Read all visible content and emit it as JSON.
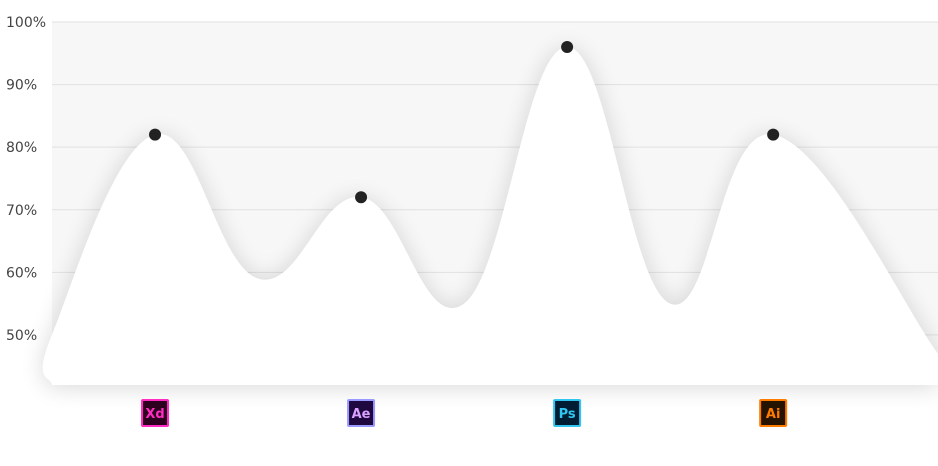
{
  "chart_data": {
    "type": "area",
    "title": "",
    "xlabel": "",
    "ylabel": "",
    "ylim": [
      42,
      100
    ],
    "y_ticks": [
      50,
      60,
      70,
      80,
      90,
      100
    ],
    "y_tick_labels": [
      "50%",
      "60%",
      "70%",
      "80%",
      "90%",
      "100%"
    ],
    "grid": true,
    "curve_color": "#ffffff",
    "background_band_color": "#f7f7f7",
    "point_color": "#222222",
    "series": [
      {
        "name": "",
        "points": [
          {
            "x": 0.0,
            "y": 42
          },
          {
            "x": 0.0,
            "y": 50
          },
          {
            "x": 0.5,
            "y": 82,
            "marker": true
          },
          {
            "x": 1.0,
            "y": 59
          },
          {
            "x": 1.5,
            "y": 72,
            "marker": true
          },
          {
            "x": 2.0,
            "y": 55
          },
          {
            "x": 2.5,
            "y": 96,
            "marker": true
          },
          {
            "x": 3.0,
            "y": 55
          },
          {
            "x": 3.5,
            "y": 82,
            "marker": true
          },
          {
            "x": 4.3,
            "y": 47
          }
        ]
      }
    ],
    "categories": [
      {
        "label": "Xd",
        "x": 0.5,
        "bg": "#2e001f",
        "fg": "#ff2bc2",
        "border": "#ff2bc2"
      },
      {
        "label": "Ae",
        "x": 1.5,
        "bg": "#1f0740",
        "fg": "#d8a1ff",
        "border": "#9999ff"
      },
      {
        "label": "Ps",
        "x": 2.5,
        "bg": "#001d34",
        "fg": "#31c5f0",
        "border": "#31c5f0"
      },
      {
        "label": "Ai",
        "x": 3.5,
        "bg": "#261300",
        "fg": "#ff7c00",
        "border": "#ff7c00"
      }
    ],
    "x_range": [
      0,
      4.3
    ]
  }
}
